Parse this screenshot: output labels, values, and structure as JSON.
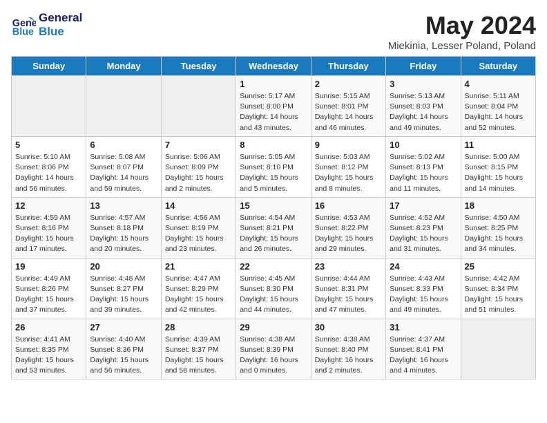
{
  "header": {
    "logo_line1": "General",
    "logo_line2": "Blue",
    "month_title": "May 2024",
    "subtitle": "Miekinia, Lesser Poland, Poland"
  },
  "weekdays": [
    "Sunday",
    "Monday",
    "Tuesday",
    "Wednesday",
    "Thursday",
    "Friday",
    "Saturday"
  ],
  "weeks": [
    [
      {
        "day": "",
        "info": ""
      },
      {
        "day": "",
        "info": ""
      },
      {
        "day": "",
        "info": ""
      },
      {
        "day": "1",
        "info": "Sunrise: 5:17 AM\nSunset: 8:00 PM\nDaylight: 14 hours\nand 43 minutes."
      },
      {
        "day": "2",
        "info": "Sunrise: 5:15 AM\nSunset: 8:01 PM\nDaylight: 14 hours\nand 46 minutes."
      },
      {
        "day": "3",
        "info": "Sunrise: 5:13 AM\nSunset: 8:03 PM\nDaylight: 14 hours\nand 49 minutes."
      },
      {
        "day": "4",
        "info": "Sunrise: 5:11 AM\nSunset: 8:04 PM\nDaylight: 14 hours\nand 52 minutes."
      }
    ],
    [
      {
        "day": "5",
        "info": "Sunrise: 5:10 AM\nSunset: 8:06 PM\nDaylight: 14 hours\nand 56 minutes."
      },
      {
        "day": "6",
        "info": "Sunrise: 5:08 AM\nSunset: 8:07 PM\nDaylight: 14 hours\nand 59 minutes."
      },
      {
        "day": "7",
        "info": "Sunrise: 5:06 AM\nSunset: 8:09 PM\nDaylight: 15 hours\nand 2 minutes."
      },
      {
        "day": "8",
        "info": "Sunrise: 5:05 AM\nSunset: 8:10 PM\nDaylight: 15 hours\nand 5 minutes."
      },
      {
        "day": "9",
        "info": "Sunrise: 5:03 AM\nSunset: 8:12 PM\nDaylight: 15 hours\nand 8 minutes."
      },
      {
        "day": "10",
        "info": "Sunrise: 5:02 AM\nSunset: 8:13 PM\nDaylight: 15 hours\nand 11 minutes."
      },
      {
        "day": "11",
        "info": "Sunrise: 5:00 AM\nSunset: 8:15 PM\nDaylight: 15 hours\nand 14 minutes."
      }
    ],
    [
      {
        "day": "12",
        "info": "Sunrise: 4:59 AM\nSunset: 8:16 PM\nDaylight: 15 hours\nand 17 minutes."
      },
      {
        "day": "13",
        "info": "Sunrise: 4:57 AM\nSunset: 8:18 PM\nDaylight: 15 hours\nand 20 minutes."
      },
      {
        "day": "14",
        "info": "Sunrise: 4:56 AM\nSunset: 8:19 PM\nDaylight: 15 hours\nand 23 minutes."
      },
      {
        "day": "15",
        "info": "Sunrise: 4:54 AM\nSunset: 8:21 PM\nDaylight: 15 hours\nand 26 minutes."
      },
      {
        "day": "16",
        "info": "Sunrise: 4:53 AM\nSunset: 8:22 PM\nDaylight: 15 hours\nand 29 minutes."
      },
      {
        "day": "17",
        "info": "Sunrise: 4:52 AM\nSunset: 8:23 PM\nDaylight: 15 hours\nand 31 minutes."
      },
      {
        "day": "18",
        "info": "Sunrise: 4:50 AM\nSunset: 8:25 PM\nDaylight: 15 hours\nand 34 minutes."
      }
    ],
    [
      {
        "day": "19",
        "info": "Sunrise: 4:49 AM\nSunset: 8:26 PM\nDaylight: 15 hours\nand 37 minutes."
      },
      {
        "day": "20",
        "info": "Sunrise: 4:48 AM\nSunset: 8:27 PM\nDaylight: 15 hours\nand 39 minutes."
      },
      {
        "day": "21",
        "info": "Sunrise: 4:47 AM\nSunset: 8:29 PM\nDaylight: 15 hours\nand 42 minutes."
      },
      {
        "day": "22",
        "info": "Sunrise: 4:45 AM\nSunset: 8:30 PM\nDaylight: 15 hours\nand 44 minutes."
      },
      {
        "day": "23",
        "info": "Sunrise: 4:44 AM\nSunset: 8:31 PM\nDaylight: 15 hours\nand 47 minutes."
      },
      {
        "day": "24",
        "info": "Sunrise: 4:43 AM\nSunset: 8:33 PM\nDaylight: 15 hours\nand 49 minutes."
      },
      {
        "day": "25",
        "info": "Sunrise: 4:42 AM\nSunset: 8:34 PM\nDaylight: 15 hours\nand 51 minutes."
      }
    ],
    [
      {
        "day": "26",
        "info": "Sunrise: 4:41 AM\nSunset: 8:35 PM\nDaylight: 15 hours\nand 53 minutes."
      },
      {
        "day": "27",
        "info": "Sunrise: 4:40 AM\nSunset: 8:36 PM\nDaylight: 15 hours\nand 56 minutes."
      },
      {
        "day": "28",
        "info": "Sunrise: 4:39 AM\nSunset: 8:37 PM\nDaylight: 15 hours\nand 58 minutes."
      },
      {
        "day": "29",
        "info": "Sunrise: 4:38 AM\nSunset: 8:39 PM\nDaylight: 16 hours\nand 0 minutes."
      },
      {
        "day": "30",
        "info": "Sunrise: 4:38 AM\nSunset: 8:40 PM\nDaylight: 16 hours\nand 2 minutes."
      },
      {
        "day": "31",
        "info": "Sunrise: 4:37 AM\nSunset: 8:41 PM\nDaylight: 16 hours\nand 4 minutes."
      },
      {
        "day": "",
        "info": ""
      }
    ]
  ]
}
